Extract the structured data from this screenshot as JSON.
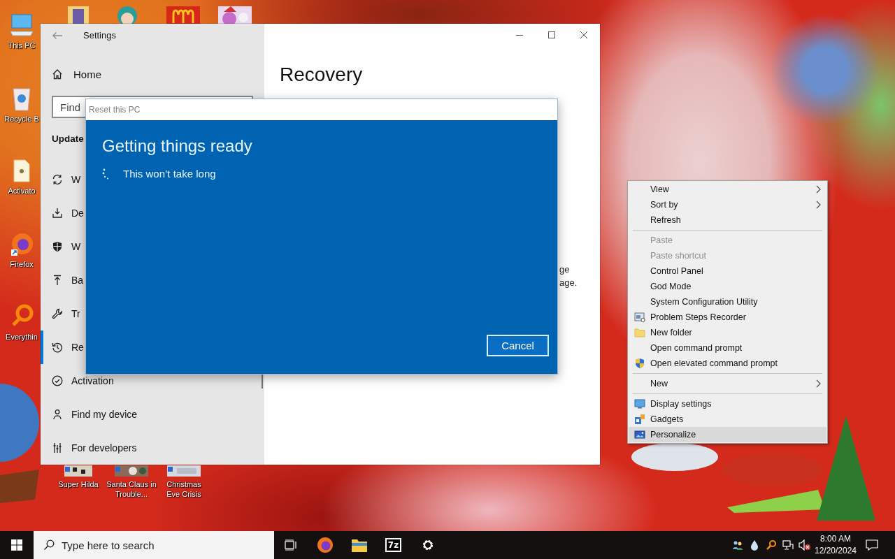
{
  "desktop": {
    "shortcuts": [
      {
        "label": "This PC"
      },
      {
        "label": "Recycle B"
      },
      {
        "label": "Activato"
      },
      {
        "label": "Firefox"
      },
      {
        "label": "Everythin"
      },
      {
        "label": "Super Hilda"
      },
      {
        "label": "Santa Claus in Trouble..."
      },
      {
        "label": "Christmas Eve Crisis"
      }
    ]
  },
  "settings": {
    "title": "Settings",
    "home": "Home",
    "search": {
      "placeholder": "Find"
    },
    "section": "Update",
    "nav": [
      {
        "label": "W",
        "selected": false
      },
      {
        "label": "De",
        "selected": false
      },
      {
        "label": "W",
        "selected": false
      },
      {
        "label": "Ba",
        "selected": false
      },
      {
        "label": "Tr",
        "selected": false
      },
      {
        "label": "Re",
        "selected": true
      },
      {
        "label": "Activation",
        "selected": false
      },
      {
        "label": "Find my device",
        "selected": false
      },
      {
        "label": "For developers",
        "selected": false
      }
    ],
    "page_title": "Recovery",
    "body_fragments": [
      "ge",
      "age."
    ]
  },
  "dialog": {
    "title": "Reset this PC",
    "heading": "Getting things ready",
    "status": "This won’t take long",
    "button": "Cancel"
  },
  "context_menu": {
    "items": [
      {
        "kind": "item",
        "label": "View",
        "submenu": true,
        "disabled": false,
        "selected": false
      },
      {
        "kind": "item",
        "label": "Sort by",
        "submenu": true,
        "disabled": false,
        "selected": false
      },
      {
        "kind": "item",
        "label": "Refresh",
        "submenu": false,
        "disabled": false,
        "selected": false
      },
      {
        "kind": "separator"
      },
      {
        "kind": "item",
        "label": "Paste",
        "submenu": false,
        "disabled": true,
        "selected": false
      },
      {
        "kind": "item",
        "label": "Paste shortcut",
        "submenu": false,
        "disabled": true,
        "selected": false
      },
      {
        "kind": "item",
        "label": "Control Panel",
        "submenu": false,
        "disabled": false,
        "selected": false
      },
      {
        "kind": "item",
        "label": "God Mode",
        "submenu": false,
        "disabled": false,
        "selected": false
      },
      {
        "kind": "item",
        "label": "System Configuration Utility",
        "submenu": false,
        "disabled": false,
        "selected": false
      },
      {
        "kind": "item",
        "label": "Problem Steps Recorder",
        "submenu": false,
        "disabled": false,
        "selected": false
      },
      {
        "kind": "item",
        "label": "New folder",
        "submenu": false,
        "disabled": false,
        "selected": false
      },
      {
        "kind": "item",
        "label": "Open command prompt",
        "submenu": false,
        "disabled": false,
        "selected": false
      },
      {
        "kind": "item",
        "label": "Open elevated command prompt",
        "submenu": false,
        "disabled": false,
        "selected": false
      },
      {
        "kind": "separator"
      },
      {
        "kind": "item",
        "label": "New",
        "submenu": true,
        "disabled": false,
        "selected": false
      },
      {
        "kind": "separator"
      },
      {
        "kind": "item",
        "label": "Display settings",
        "submenu": false,
        "disabled": false,
        "selected": false
      },
      {
        "kind": "item",
        "label": "Gadgets",
        "submenu": false,
        "disabled": false,
        "selected": false
      },
      {
        "kind": "item",
        "label": "Personalize",
        "submenu": false,
        "disabled": false,
        "selected": true
      }
    ]
  },
  "taskbar": {
    "search": {
      "placeholder": "Type here to search"
    },
    "archive_app": "7z",
    "time": "8:00 AM",
    "date": "12/20/2024"
  }
}
